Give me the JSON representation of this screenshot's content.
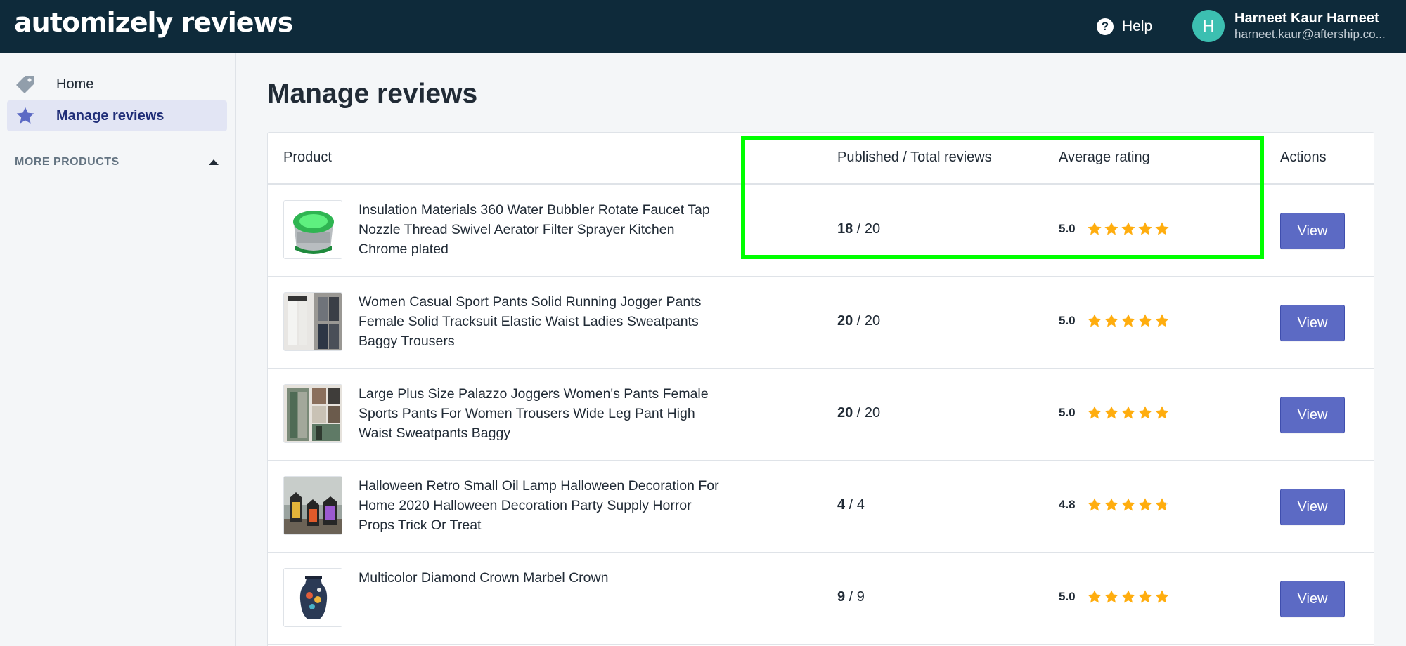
{
  "app": {
    "logo_text": "automizely reviews"
  },
  "header": {
    "help_label": "Help",
    "help_icon": "question-circle-icon",
    "user": {
      "avatar_letter": "H",
      "avatar_color": "#3cbfb1",
      "name": "Harneet Kaur Harneet",
      "email": "harneet.kaur@aftership.co..."
    }
  },
  "sidebar": {
    "items": [
      {
        "label": "Home",
        "icon": "tag-icon",
        "active": false
      },
      {
        "label": "Manage reviews",
        "icon": "star-icon",
        "active": true
      }
    ],
    "more_products_label": "MORE PRODUCTS"
  },
  "main": {
    "title": "Manage reviews",
    "columns": {
      "product": "Product",
      "published": "Published / Total reviews",
      "rating": "Average rating",
      "actions": "Actions"
    },
    "rows": [
      {
        "name": "Insulation Materials 360 Water Bubbler Rotate Faucet Tap Nozzle Thread Swivel Aerator Filter Sprayer Kitchen Chrome plated",
        "published": "18",
        "separator": " / ",
        "total": "20",
        "rating": "5.0",
        "stars": 5,
        "action": "View",
        "thumb": "faucet-aerator"
      },
      {
        "name": "Women Casual Sport Pants Solid Running Jogger Pants Female Solid Tracksuit Elastic Waist Ladies Sweatpants Baggy Trousers",
        "published": "20",
        "separator": " / ",
        "total": "20",
        "rating": "5.0",
        "stars": 5,
        "action": "View",
        "thumb": "jogger-pants"
      },
      {
        "name": "Large Plus Size Palazzo Joggers Women's Pants Female Sports Pants For Women Trousers Wide Leg Pant High Waist Sweatpants Baggy",
        "published": "20",
        "separator": " / ",
        "total": "20",
        "rating": "5.0",
        "stars": 5,
        "action": "View",
        "thumb": "palazzo-pants"
      },
      {
        "name": "Halloween Retro Small Oil Lamp Halloween Decoration For Home 2020 Halloween Decoration Party Supply Horror Props Trick Or Treat",
        "published": "4",
        "separator": " / ",
        "total": "4",
        "rating": "4.8",
        "stars": 4.8,
        "action": "View",
        "thumb": "oil-lamps"
      },
      {
        "name": "Multicolor Diamond Crown Marbel Crown",
        "published": "9",
        "separator": " / ",
        "total": "9",
        "rating": "5.0",
        "stars": 5,
        "action": "View",
        "thumb": "crown-vase"
      }
    ]
  },
  "colors": {
    "topbar": "#0e2a3a",
    "accent": "#5c6ac4",
    "star": "#ffad0e",
    "highlight": "#00ff00"
  }
}
